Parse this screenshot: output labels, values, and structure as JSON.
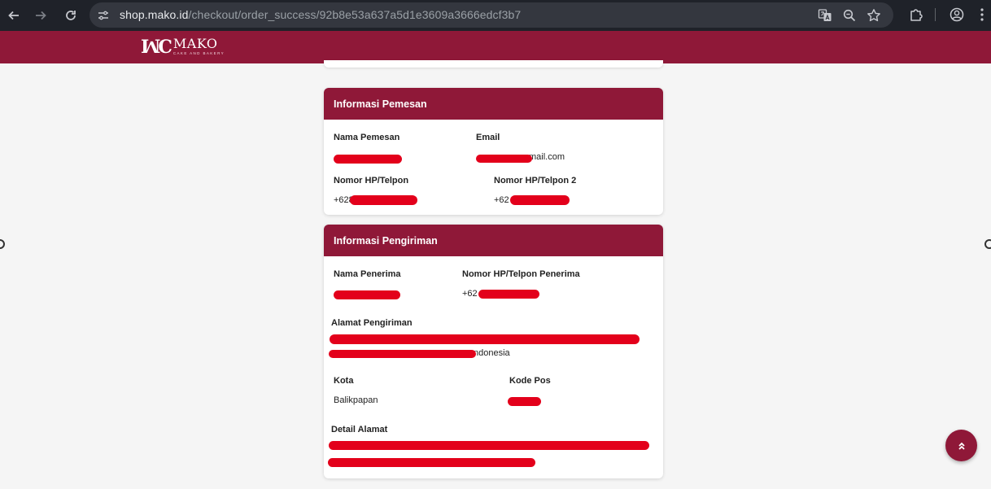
{
  "browser": {
    "url_host": "shop.mako.id",
    "url_path": "/checkout/order_success/92b8e53a637a5d1e3609a3666edcf3b7",
    "icons": [
      "back-icon",
      "forward-icon",
      "reload-icon",
      "site-info-icon",
      "translate-icon",
      "zoom-icon",
      "bookmark-star-icon",
      "extensions-icon",
      "profile-icon",
      "menu-icon"
    ]
  },
  "site": {
    "brand": "MAKO",
    "brand_mark": "ꟽC",
    "tagline": "CAKE AND BAKERY",
    "accent_color": "#8f1838"
  },
  "pemesan": {
    "title": "Informasi Pemesan",
    "nama_label": "Nama Pemesan",
    "email_label": "Email",
    "email_value": "mail.com",
    "hp_label": "Nomor HP/Telpon",
    "hp_value": "+628",
    "hp2_label": "Nomor HP/Telpon 2",
    "hp2_value": "+62"
  },
  "pengiriman": {
    "title": "Informasi Pengiriman",
    "penerima_label": "Nama Penerima",
    "hp_penerima_label": "Nomor HP/Telpon Penerima",
    "hp_penerima_value": "+62",
    "alamat_label": "Alamat Pengiriman",
    "alamat_value_tail": "ndonesia",
    "kota_label": "Kota",
    "kota_value": "Balikpapan",
    "kodepos_label": "Kode Pos",
    "detail_label": "Detail Alamat"
  },
  "scroll_top_icon": "double-chevron-up-icon"
}
